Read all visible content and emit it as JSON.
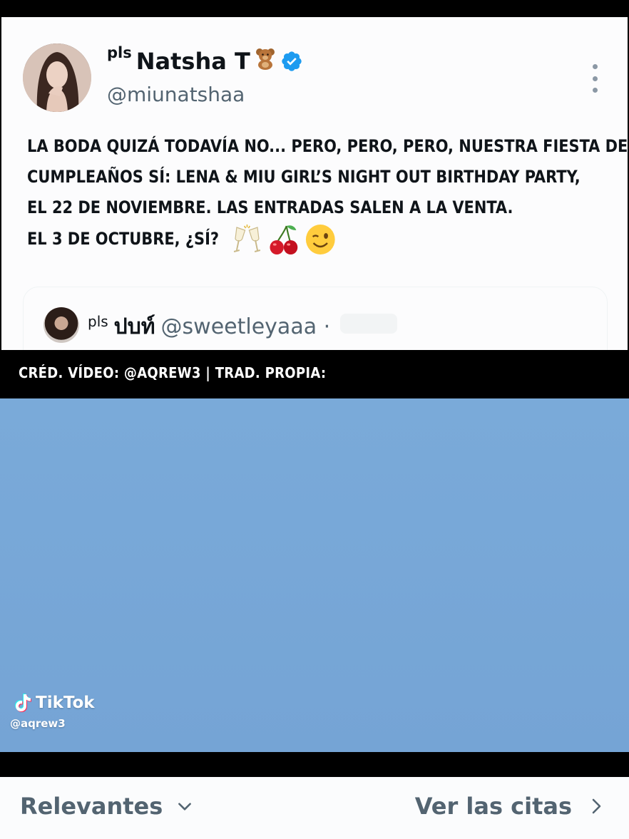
{
  "tweet": {
    "author_name_prefix": "pls",
    "author_name": "Natsha T",
    "author_emoji": "teddy-bear",
    "verified": true,
    "handle": "@miunatshaa",
    "text_lines": [
      "LA BODA QUIZÁ TODAVÍA NO... PERO, PERO, PERO, NUESTRA FIESTA DE",
      "CUMPLEAÑOS SÍ: LENA & MIU GIRL’S NIGHT OUT BIRTHDAY PARTY,",
      "EL 22 DE NOVIEMBRE. LAS ENTRADAS SALEN A LA VENTA.",
      "EL 3 DE OCTUBRE, ¿SÍ?"
    ],
    "emojis": [
      "champagne-toast",
      "cherries",
      "winking-face"
    ]
  },
  "quote": {
    "name_prefix": "pls",
    "name": "ปบท์",
    "handle": "@sweetleyaaa ·"
  },
  "caption": "CRÉD. VÍDEO: @AQREW3 | TRAD. PROPIA:",
  "video": {
    "background_color": "#77a7d7",
    "watermark": "TikTok",
    "watermark_handle": "@aqrew3"
  },
  "bottom_bar": {
    "sort_label": "Relevantes",
    "quotes_label": "Ver las citas"
  },
  "colors": {
    "accent_verified": "#1d9bf0",
    "secondary_text": "#536471"
  }
}
